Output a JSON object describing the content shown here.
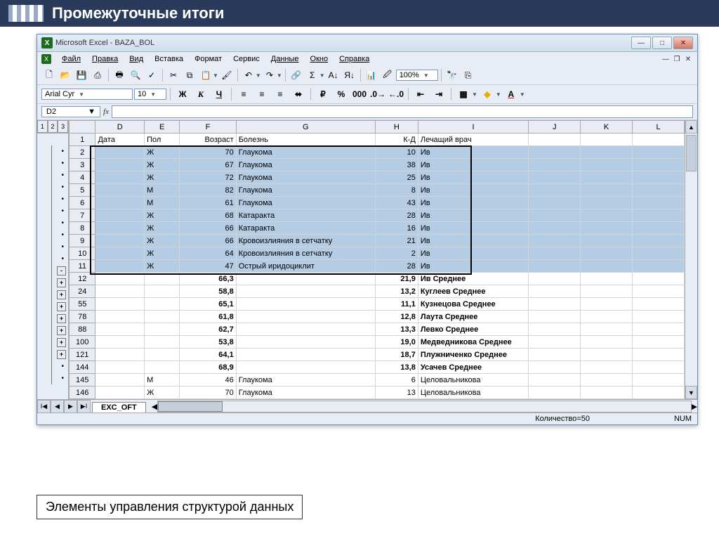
{
  "slide": {
    "title": "Промежуточные итоги",
    "callout": "Элементы управления структурой данных"
  },
  "window": {
    "title": "Microsoft Excel - BAZA_BOL"
  },
  "menu": [
    "Файл",
    "Правка",
    "Вид",
    "Вставка",
    "Формат",
    "Сервис",
    "Данные",
    "Окно",
    "Справка"
  ],
  "toolbar": {
    "zoom": "100%"
  },
  "format": {
    "font": "Arial Cyr",
    "size": "10"
  },
  "cellref": "D2",
  "cols": [
    "D",
    "E",
    "F",
    "G",
    "H",
    "I",
    "J",
    "K",
    "L"
  ],
  "headerRow": {
    "n": "1",
    "D": "Дата",
    "E": "Пол",
    "F": "Возраст",
    "G": "Болезнь",
    "H": "К-Д",
    "I": "Лечащий врач"
  },
  "rows": [
    {
      "n": "2",
      "sel": true,
      "E": "Ж",
      "F": "70",
      "G": "Глаукома",
      "H": "10",
      "I": "Ив",
      "o": "."
    },
    {
      "n": "3",
      "sel": true,
      "E": "Ж",
      "F": "67",
      "G": "Глаукома",
      "H": "38",
      "I": "Ив",
      "o": "."
    },
    {
      "n": "4",
      "sel": true,
      "E": "Ж",
      "F": "72",
      "G": "Глаукома",
      "H": "25",
      "I": "Ив",
      "o": "."
    },
    {
      "n": "5",
      "sel": true,
      "E": "М",
      "F": "82",
      "G": "Глаукома",
      "H": "8",
      "I": "Ив",
      "o": "."
    },
    {
      "n": "6",
      "sel": true,
      "E": "М",
      "F": "61",
      "G": "Глаукома",
      "H": "43",
      "I": "Ив",
      "o": "."
    },
    {
      "n": "7",
      "sel": true,
      "E": "Ж",
      "F": "68",
      "G": "Катаракта",
      "H": "28",
      "I": "Ив",
      "o": "."
    },
    {
      "n": "8",
      "sel": true,
      "E": "Ж",
      "F": "66",
      "G": "Катаракта",
      "H": "16",
      "I": "Ив",
      "o": "."
    },
    {
      "n": "9",
      "sel": true,
      "E": "Ж",
      "F": "66",
      "G": "Кровоизлияния в сетчатку",
      "H": "21",
      "I": "Ив",
      "o": "."
    },
    {
      "n": "10",
      "sel": true,
      "E": "Ж",
      "F": "64",
      "G": "Кровоизлияния в сетчатку",
      "H": "2",
      "I": "Ив",
      "o": "."
    },
    {
      "n": "11",
      "sel": true,
      "E": "Ж",
      "F": "47",
      "G": "Острый иридоциклит",
      "H": "28",
      "I": "Ив",
      "o": "."
    },
    {
      "n": "12",
      "bold": true,
      "F": "66,3",
      "H": "21,9",
      "I": "Ив Среднее",
      "o": "-"
    },
    {
      "n": "24",
      "bold": true,
      "F": "58,8",
      "H": "13,2",
      "I": "Куглеев Среднее",
      "o": "+"
    },
    {
      "n": "55",
      "bold": true,
      "F": "65,1",
      "H": "11,1",
      "I": "Кузнецова Среднее",
      "o": "+"
    },
    {
      "n": "78",
      "bold": true,
      "F": "61,8",
      "H": "12,8",
      "I": "Лаута Среднее",
      "o": "+"
    },
    {
      "n": "88",
      "bold": true,
      "F": "62,7",
      "H": "13,3",
      "I": "Левко Среднее",
      "o": "+"
    },
    {
      "n": "100",
      "bold": true,
      "F": "53,8",
      "H": "19,0",
      "I": "Медведникова Среднее",
      "o": "+"
    },
    {
      "n": "121",
      "bold": true,
      "F": "64,1",
      "H": "18,7",
      "I": "Плужниченко Среднее",
      "o": "+"
    },
    {
      "n": "144",
      "bold": true,
      "F": "68,9",
      "H": "13,8",
      "I": "Усачев Среднее",
      "o": "+"
    },
    {
      "n": "145",
      "E": "М",
      "F": "46",
      "G": "Глаукома",
      "H": "6",
      "I": "Целовальникова",
      "o": "."
    },
    {
      "n": "146",
      "E": "Ж",
      "F": "70",
      "G": "Глаукома",
      "H": "13",
      "I": "Целовальникова",
      "o": "."
    }
  ],
  "sheet_tab": "EXC_OFT",
  "status": {
    "count": "Количество=50",
    "num": "NUM"
  }
}
